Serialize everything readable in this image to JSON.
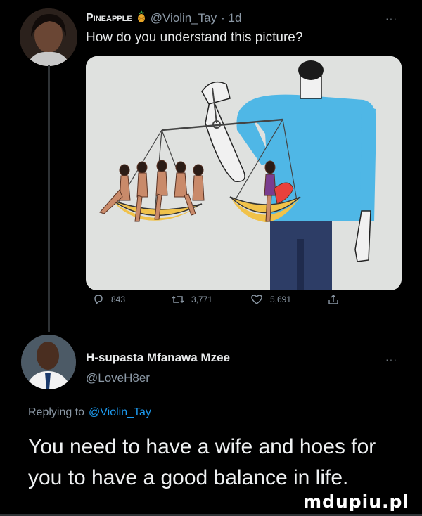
{
  "tweet": {
    "display_name": "Pineapple",
    "emoji_icon": "pineapple-icon",
    "handle": "@Violin_Tay",
    "time": "· 1d",
    "text": "How do you understand this picture?",
    "stats": {
      "replies": "843",
      "retweets": "3,771",
      "likes": "5,691"
    }
  },
  "reply": {
    "display_name": "H-supasta Mfanawa Mzee",
    "handle": "@LoveH8er",
    "replying_prefix": "Replying to",
    "replying_handle": "@Violin_Tay",
    "text_line1": "You need to have a wife and hoes for",
    "text_line2": "you to have a good balance in life."
  },
  "more_label": "···",
  "watermark": "mdupiu.pl",
  "colors": {
    "background": "#000000",
    "text": "#e7e9ea",
    "muted": "#8b98a5",
    "link": "#1d9bf0",
    "image_bg": "#dfe1df",
    "shirt": "#4fb7e6",
    "pants": "#2d3d66",
    "scale": "#f1c24a",
    "heart": "#e8413c"
  }
}
